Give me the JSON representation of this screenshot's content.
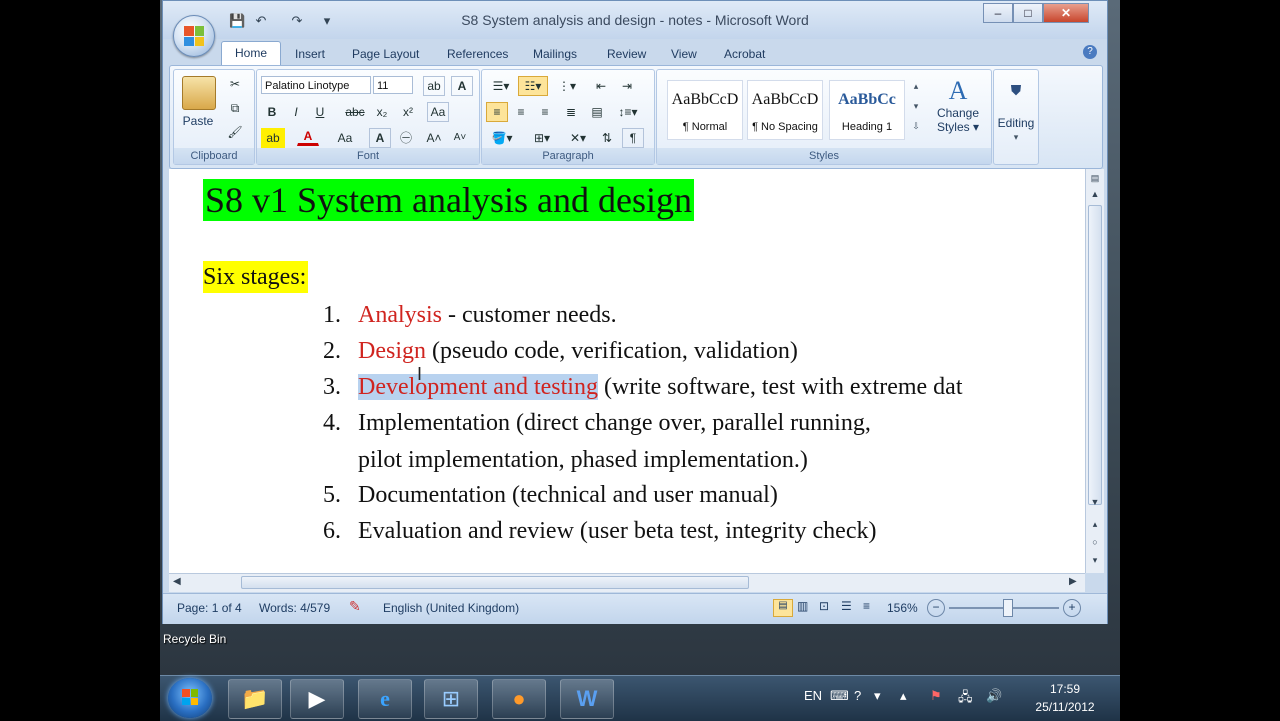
{
  "window": {
    "title": "S8  System analysis and design - notes - Microsoft Word",
    "minimize": "–",
    "maximize": "□",
    "close": "✕"
  },
  "qat": {
    "save": "💾",
    "undo": "↶",
    "redo": "↷",
    "customize": "▾"
  },
  "tabs": [
    "Home",
    "Insert",
    "Page Layout",
    "References",
    "Mailings",
    "Review",
    "View",
    "Acrobat"
  ],
  "help_icon": "?",
  "ribbon": {
    "clipboard": {
      "label": "Clipboard",
      "paste": "Paste"
    },
    "font": {
      "label": "Font",
      "family": "Palatino Linotype",
      "size": "11"
    },
    "paragraph": {
      "label": "Paragraph"
    },
    "styles": {
      "label": "Styles",
      "items": [
        {
          "sample": "AaBbCcD",
          "name": "¶ Normal"
        },
        {
          "sample": "AaBbCcD",
          "name": "¶ No Spacing"
        },
        {
          "sample": "AaBbCc",
          "name": "Heading 1"
        }
      ],
      "change": "Change",
      "change2": "Styles ▾"
    },
    "editing": {
      "label": "Editing"
    }
  },
  "document": {
    "title": "S8 v1 System analysis and design",
    "subtitle": "Six stages:",
    "items": [
      {
        "num": "1.",
        "red": "Analysis",
        "rest": " - customer needs."
      },
      {
        "num": "2.",
        "red": "Design",
        "rest": " (pseudo code, verification, validation)"
      },
      {
        "num": "3.",
        "red": "Development and testing",
        "rest": " (write software, test with extreme dat"
      },
      {
        "num": "4.",
        "red": "",
        "rest": "Implementation (direct change over, parallel running,"
      },
      {
        "num": "",
        "red": "",
        "rest": "pilot implementation, phased implementation.)"
      },
      {
        "num": "5.",
        "red": "",
        "rest": "Documentation (technical and user manual)"
      },
      {
        "num": "6.",
        "red": "",
        "rest": "Evaluation and review (user beta test, integrity check)"
      }
    ]
  },
  "status": {
    "page": "Page: 1 of 4",
    "words": "Words: 4/579",
    "language": "English (United Kingdom)",
    "zoom": "156%"
  },
  "desktop": {
    "recycle": "Recycle Bin"
  },
  "taskbar": {
    "lang": "EN",
    "time": "17:59",
    "date": "25/11/2012"
  },
  "colors": {
    "title_highlight": "#00ff00",
    "subtitle_highlight": "#ffff00",
    "accent_red": "#d0241f"
  }
}
